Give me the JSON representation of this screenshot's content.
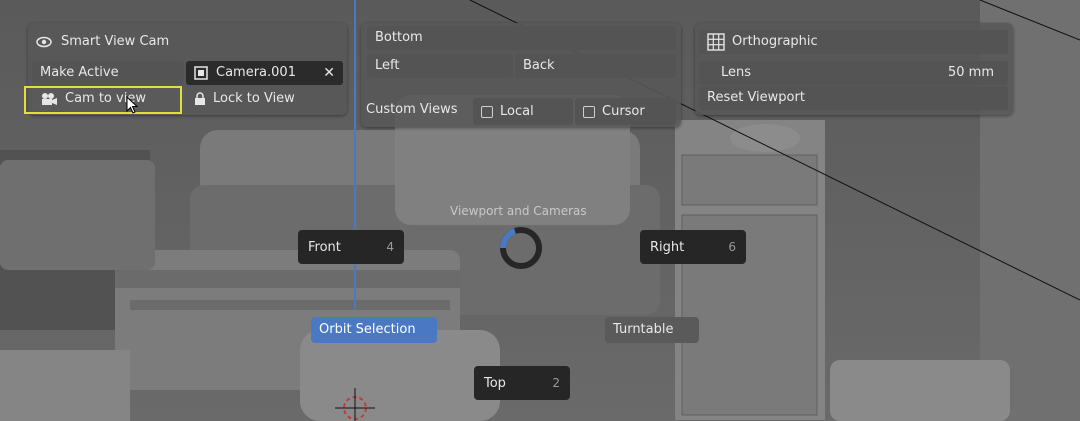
{
  "smart_view": {
    "title": "Smart View Cam",
    "make_active": "Make Active",
    "camera_name": "Camera.001",
    "cam_to_view": "Cam to view",
    "lock_to_view": "Lock to View"
  },
  "views": {
    "bottom": "Bottom",
    "left": "Left",
    "back": "Back",
    "custom_views": "Custom Views",
    "local": "Local",
    "cursor": "Cursor"
  },
  "ortho": {
    "title": "Orthographic",
    "lens_label": "Lens",
    "lens_value": "50 mm",
    "reset_viewport": "Reset Viewport"
  },
  "pie": {
    "title": "Viewport and Cameras",
    "front": "Front",
    "front_key": "4",
    "right": "Right",
    "right_key": "6",
    "top": "Top",
    "top_key": "2",
    "orbit_selection": "Orbit Selection",
    "turntable": "Turntable"
  },
  "colors": {
    "accent": "#4a78c2",
    "highlight": "#e3df3a"
  }
}
